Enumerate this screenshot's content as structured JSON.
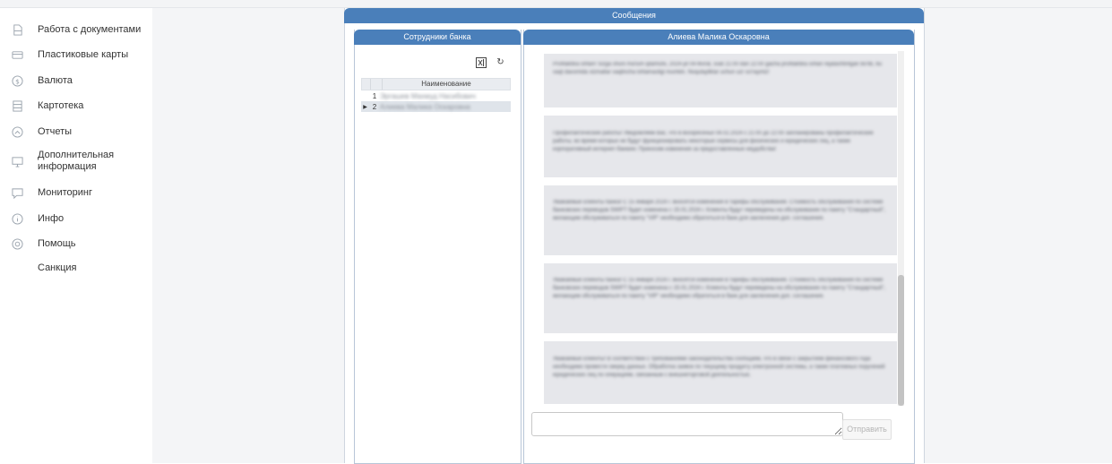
{
  "sidebar": {
    "items": [
      {
        "label": "Работа с документами",
        "icon": "document-icon"
      },
      {
        "label": "Пластиковые карты",
        "icon": "card-icon"
      },
      {
        "label": "Валюта",
        "icon": "currency-icon"
      },
      {
        "label": "Картотека",
        "icon": "cabinet-icon"
      },
      {
        "label": "Отчеты",
        "icon": "report-icon"
      },
      {
        "label": "Дополнительная\nинформация",
        "icon": "monitor-icon"
      },
      {
        "label": "Мониторинг",
        "icon": "chat-icon"
      },
      {
        "label": "Инфо",
        "icon": "info-icon"
      },
      {
        "label": "Помощь",
        "icon": "help-icon"
      },
      {
        "label": "Санкция",
        "icon": ""
      }
    ]
  },
  "messages_panel": {
    "title": "Сообщения"
  },
  "employees": {
    "title": "Сотрудники банка",
    "column_name": "Наименование",
    "rows": [
      {
        "num": "1",
        "name": "Эргашев Махмуд Насибович",
        "selected": false
      },
      {
        "num": "2",
        "name": "Алиева Малика Оскаровна",
        "selected": true
      }
    ]
  },
  "chat": {
    "title": "Алиева Малика Оскаровна",
    "messages": [
      "Profilaktika ishlari! Sizga shuni ma'lum qilamizki, 2024-yil 04-fevral, soat 21:00 dan 22:00 gacha profilaktika ishlari rejalashtirilgan bo'lib, bu vaqt davomida xizmatlar vaqtincha ishlamasligi mumkin. Noqulayliklar uchun uzr so'raymiz!",
      "Профилактические работы! Уведомляем Вас, что в воскресенье 04.02.2024 с 21:00 до 22:00 запланированы профилактические работы, во время которых не будут функционировать некоторые сервисы для физических и юридических лиц, а также корпоративный интернет-банкинг. Приносим извинения за предоставленные неудобства!",
      "Уважаемые клиенты банка! С 15 января 2024 г. вносятся изменения в тарифы обслуживания. Стоимость обслуживания по системе банковских переводов SWIFT будет изменена с 15.01.2024 г. Клиенты будут переведены на обслуживание по пакету \"Стандартный\", желающим обслуживаться по пакету \"VIP\" необходимо обратиться в банк для заключения доп. соглашения.",
      "Уважаемые клиенты банка! С 15 января 2024 г. вносятся изменения в тарифы обслуживания. Стоимость обслуживания по системе банковских переводов SWIFT будет изменена с 15.01.2024 г. Клиенты будут переведены на обслуживание по пакету \"Стандартный\", желающим обслуживаться по пакету \"VIP\" необходимо обратиться в банк для заключения доп. соглашения.",
      "Уважаемые клиенты! В соответствии с требованиями законодательства сообщаем, что в связи с закрытием финансового года необходимо провести сверку данных. Обработка заявок по текущему продукту электронной системы, а также платежных поручений юридических лиц по операциям, связанным с внешнеторговой деятельностью."
    ],
    "input_placeholder": "",
    "send_label": "Отправить"
  }
}
